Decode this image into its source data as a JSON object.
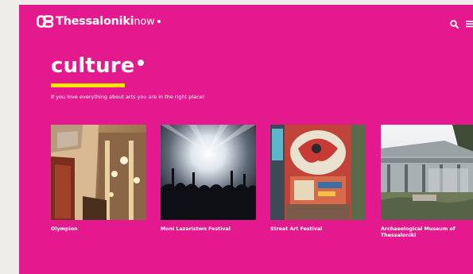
{
  "brand": {
    "bold": "Thessaloniki",
    "light": "now"
  },
  "page": {
    "title": "culture",
    "subtitle": "If you love everything about arts you are in the right place!"
  },
  "cards": [
    {
      "label": "Olympion",
      "image": "theater-facade-photo"
    },
    {
      "label": "Moni Lazaristwn Festival",
      "image": "concert-crowd-photo"
    },
    {
      "label": "Street Art Festival",
      "image": "graffiti-wall-photo"
    },
    {
      "label": "Archaeological Museum of Thessaloniki",
      "image": "museum-building-photo"
    }
  ],
  "colors": {
    "background": "#e5198e",
    "accent": "#ffe600",
    "text": "#ffffff",
    "outer": "#eeedea"
  },
  "icons": [
    "logo-mark-icon",
    "search-icon",
    "menu-icon"
  ]
}
